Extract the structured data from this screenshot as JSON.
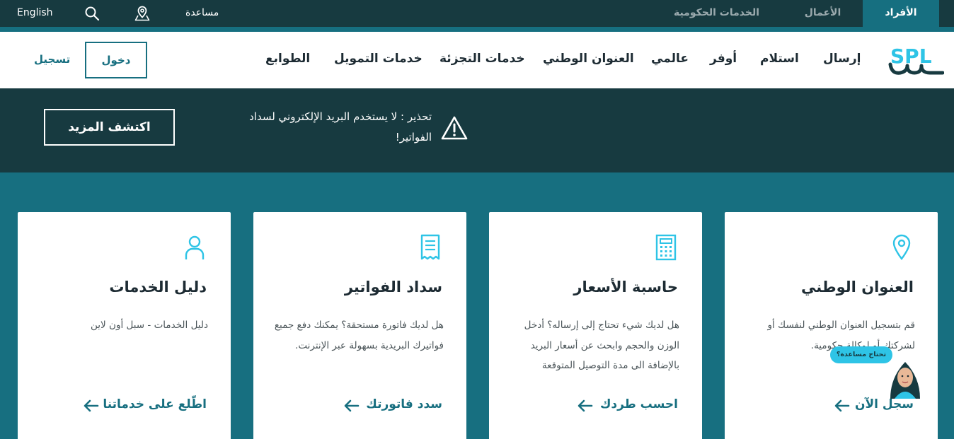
{
  "topbar": {
    "language": "English",
    "help": "مساعدة",
    "segments": [
      "الأفراد",
      "الأعمال",
      "الخدمات الحكومية"
    ],
    "active_segment": "الأفراد"
  },
  "header": {
    "logo_text": "SPL",
    "nav": [
      "إرسال",
      "استلام",
      "أوفر",
      "عالمي",
      "العنوان الوطني",
      "خدمات التجزئة",
      "خدمات التمويل",
      "الطوابع"
    ],
    "login": "دخول",
    "register": "تسجيل"
  },
  "banner": {
    "warning": "تحذير : لا يستخدم البريد الإلكتروني لسداد الفواتير!",
    "cta": "اكتشف المزيد"
  },
  "cards": [
    {
      "icon": "location-pin-icon",
      "title": "العنوان الوطني",
      "description": "قم بتسجيل العنوان الوطني لنفسك أو لشركتك أو لوكالة حكومية.",
      "link": "سجل الآن"
    },
    {
      "icon": "calculator-icon",
      "title": "حاسبة الأسعار",
      "description": "هل لديك شيء تحتاج إلى إرساله؟ أدخل الوزن والحجم وابحث عن أسعار البريد بالإضافة الى مدة التوصيل المتوقعة",
      "link": "احسب طردك"
    },
    {
      "icon": "receipt-icon",
      "title": "سداد الفواتير",
      "description": "هل لديك فاتورة مستحقة؟ يمكنك دفع جميع فواتيرك البريدية بسهولة عبر الإنترنت.",
      "link": "سدد فاتورتك"
    },
    {
      "icon": "user-icon",
      "title": "دليل الخدمات",
      "description": "دليل الخدمات - سبل أون لاين",
      "link": "اطّلع على خدماتنا"
    }
  ],
  "assistant": {
    "bubble": "تحتاج مساعدة؟"
  },
  "colors": {
    "teal": "#176f80",
    "dark": "#173a40",
    "accent": "#2ec4e6"
  }
}
